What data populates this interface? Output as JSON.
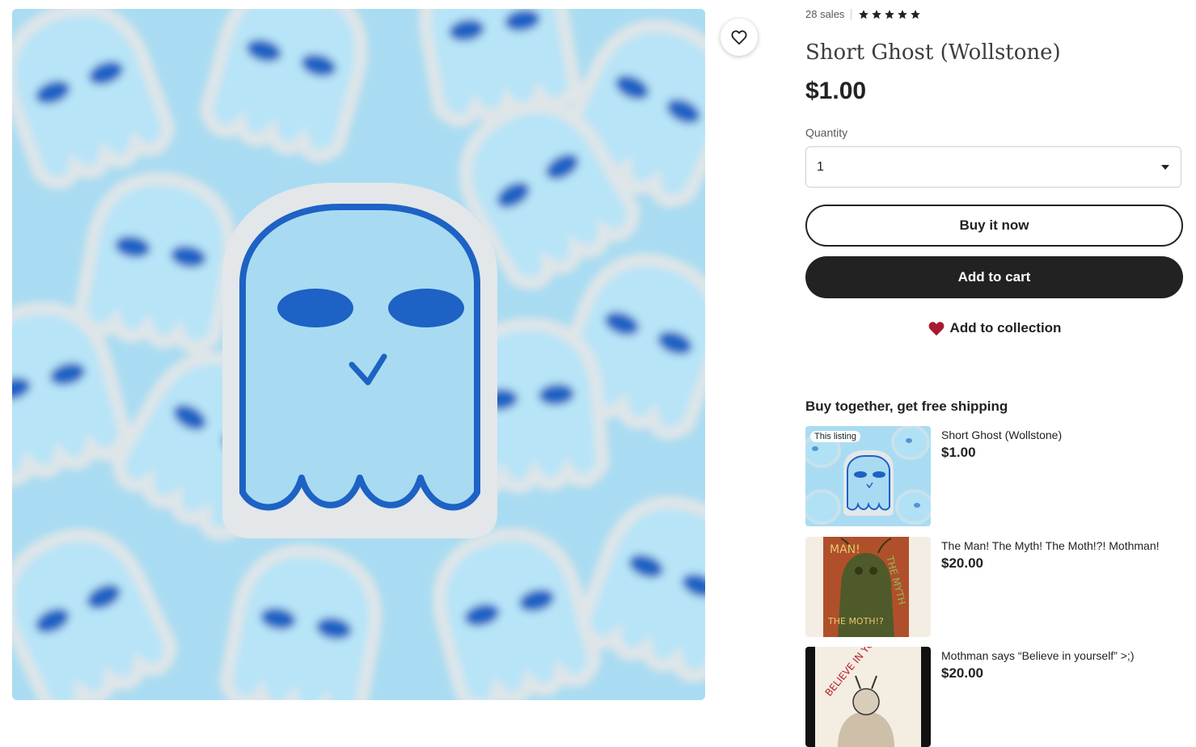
{
  "listing": {
    "sales": "28 sales",
    "rating_stars": 5,
    "title": "Short Ghost (Wollstone)",
    "price": "$1.00"
  },
  "quantity": {
    "label": "Quantity",
    "value": "1"
  },
  "actions": {
    "buy_now": "Buy it now",
    "add_to_cart": "Add to cart",
    "add_to_collection": "Add to collection"
  },
  "bundle": {
    "title": "Buy together, get free shipping",
    "badge": "This listing",
    "items": [
      {
        "name": "Short Ghost (Wollstone)",
        "price": "$1.00"
      },
      {
        "name": "The Man! The Myth! The Moth!?! Mothman!",
        "price": "$20.00"
      },
      {
        "name": "Mothman says “Believe in yourself” >;)",
        "price": "$20.00"
      }
    ]
  },
  "image_text": {
    "poster_top": "MAN!",
    "poster_side": "THE MYTH",
    "poster_bottom": "THE MOTH!?",
    "card_text": "BELIEVE IN YOURSELF"
  },
  "colors": {
    "sticker_blue": "#a9dcf2",
    "ghost_outline": "#1d62c4",
    "heart_red": "#a61a2e",
    "button_dark": "#222222"
  },
  "icons": {
    "favorite": "heart-outline-icon",
    "collection": "heart-filled-icon",
    "rating": "star-icon",
    "dropdown": "caret-down-icon"
  }
}
